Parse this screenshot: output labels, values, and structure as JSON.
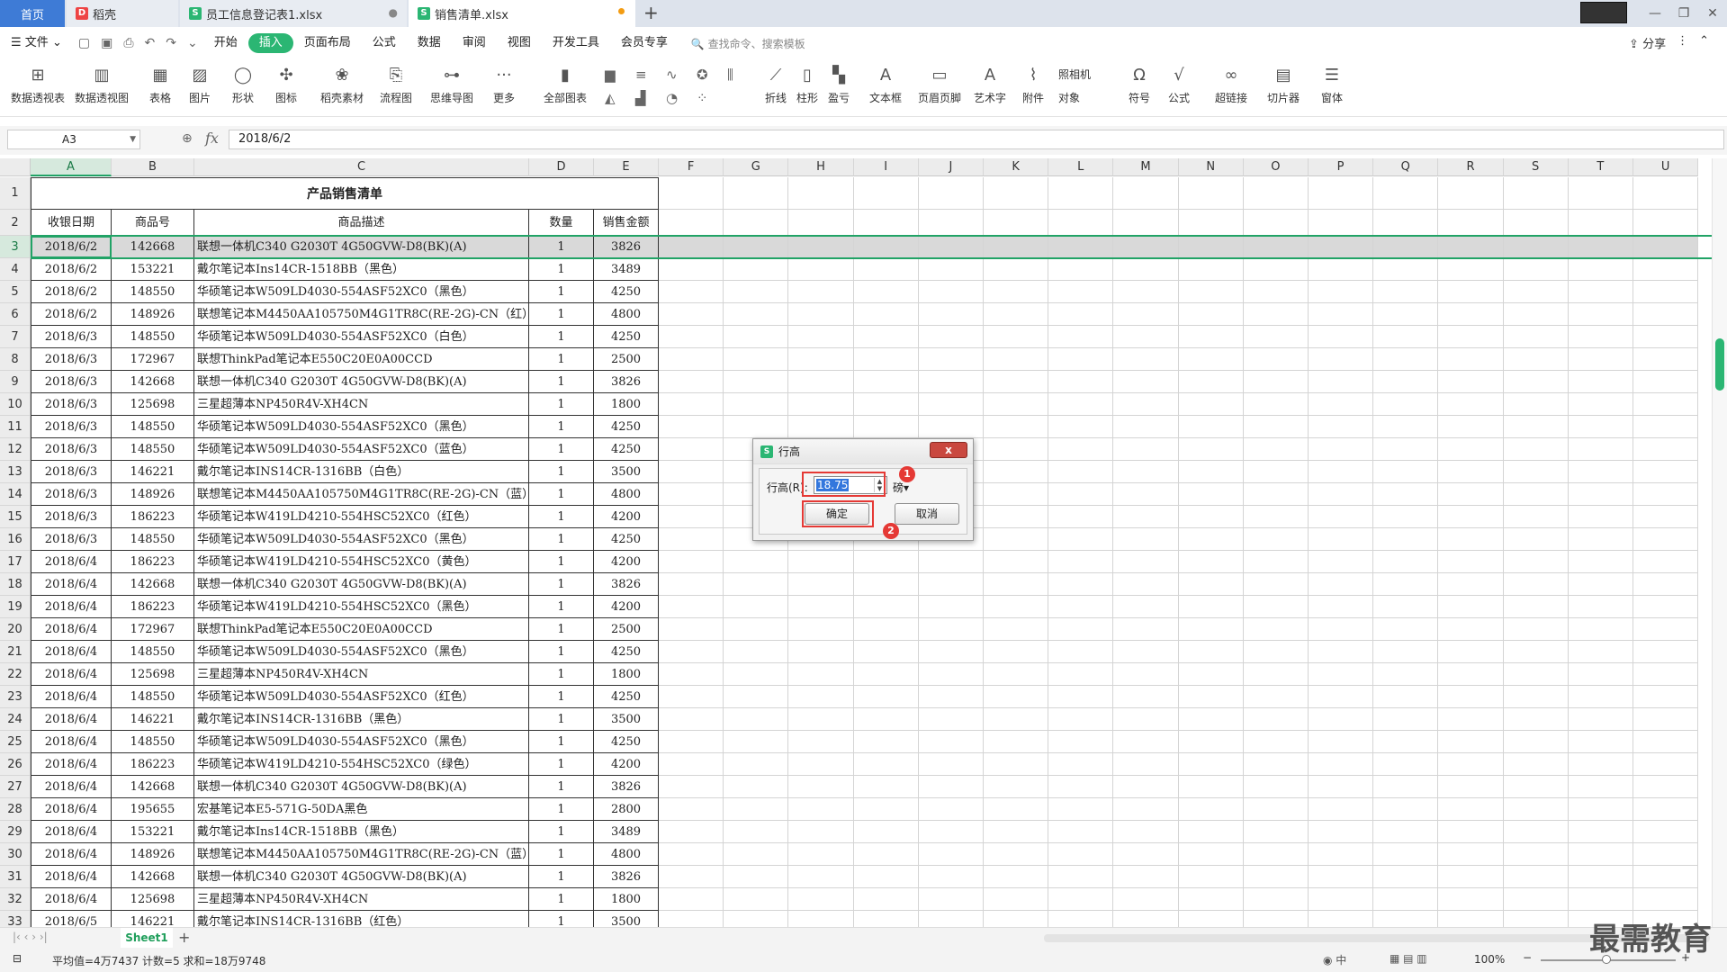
{
  "tabs": {
    "home": "首页",
    "docer": "稻壳",
    "file1": "员工信息登记表1.xlsx",
    "file2": "销售清单.xlsx"
  },
  "menu": {
    "file": "文件",
    "items": [
      "开始",
      "插入",
      "页面布局",
      "公式",
      "数据",
      "审阅",
      "视图",
      "开发工具",
      "会员专享"
    ],
    "active": "插入",
    "search": "查找命令、搜索模板",
    "right_share": "分享"
  },
  "ribbon": [
    {
      "label": "数据透视表",
      "icon": "pivot-table-icon"
    },
    {
      "label": "数据透视图",
      "icon": "pivot-chart-icon"
    },
    {
      "label": "表格",
      "icon": "table-icon"
    },
    {
      "label": "图片",
      "icon": "picture-icon"
    },
    {
      "label": "形状",
      "icon": "shape-icon"
    },
    {
      "label": "图标",
      "icon": "icon-library-icon"
    },
    {
      "label": "稻壳素材",
      "icon": "material-icon"
    },
    {
      "label": "流程图",
      "icon": "flowchart-icon"
    },
    {
      "label": "思维导图",
      "icon": "mindmap-icon"
    },
    {
      "label": "更多",
      "icon": "more-icon"
    },
    {
      "label": "全部图表",
      "icon": "all-charts-icon"
    },
    {
      "label": "折线",
      "icon": "sparkline-line-icon"
    },
    {
      "label": "柱形",
      "icon": "sparkline-column-icon"
    },
    {
      "label": "盈亏",
      "icon": "sparkline-winloss-icon"
    },
    {
      "label": "文本框",
      "icon": "textbox-icon"
    },
    {
      "label": "页眉页脚",
      "icon": "header-footer-icon"
    },
    {
      "label": "艺术字",
      "icon": "wordart-icon"
    },
    {
      "label": "附件",
      "icon": "attachment-icon"
    },
    {
      "label": "符号",
      "icon": "symbol-icon"
    },
    {
      "label": "公式",
      "icon": "equation-icon"
    },
    {
      "label": "超链接",
      "icon": "hyperlink-icon"
    },
    {
      "label": "切片器",
      "icon": "slicer-icon"
    },
    {
      "label": "窗体",
      "icon": "form-icon"
    }
  ],
  "ribbon_small": {
    "camera": "照相机",
    "object": "对象"
  },
  "formula": {
    "cell_ref": "A3",
    "content": "2018/6/2",
    "fx": "fx"
  },
  "columns": [
    "A",
    "B",
    "C",
    "D",
    "E",
    "F",
    "G",
    "H",
    "I",
    "J",
    "K",
    "L",
    "M",
    "N",
    "O",
    "P",
    "Q",
    "R",
    "S",
    "T",
    "U"
  ],
  "sheet": {
    "title": "产品销售清单",
    "headers": [
      "收银日期",
      "商品号",
      "商品描述",
      "数量",
      "销售金额"
    ],
    "rows": [
      [
        "2018/6/2",
        "142668",
        "联想一体机C340 G2030T 4G50GVW-D8(BK)(A)",
        "1",
        "3826"
      ],
      [
        "2018/6/2",
        "153221",
        "戴尔笔记本Ins14CR-1518BB（黑色）",
        "1",
        "3489"
      ],
      [
        "2018/6/2",
        "148550",
        "华硕笔记本W509LD4030-554ASF52XC0（黑色）",
        "1",
        "4250"
      ],
      [
        "2018/6/2",
        "148926",
        "联想笔记本M4450AA105750M4G1TR8C(RE-2G)-CN（红）",
        "1",
        "4800"
      ],
      [
        "2018/6/3",
        "148550",
        "华硕笔记本W509LD4030-554ASF52XC0（白色）",
        "1",
        "4250"
      ],
      [
        "2018/6/3",
        "172967",
        "联想ThinkPad笔记本E550C20E0A00CCD",
        "1",
        "2500"
      ],
      [
        "2018/6/3",
        "142668",
        "联想一体机C340 G2030T 4G50GVW-D8(BK)(A)",
        "1",
        "3826"
      ],
      [
        "2018/6/3",
        "125698",
        "三星超薄本NP450R4V-XH4CN",
        "1",
        "1800"
      ],
      [
        "2018/6/3",
        "148550",
        "华硕笔记本W509LD4030-554ASF52XC0（黑色）",
        "1",
        "4250"
      ],
      [
        "2018/6/3",
        "148550",
        "华硕笔记本W509LD4030-554ASF52XC0（蓝色）",
        "1",
        "4250"
      ],
      [
        "2018/6/3",
        "146221",
        "戴尔笔记本INS14CR-1316BB（白色）",
        "1",
        "3500"
      ],
      [
        "2018/6/3",
        "148926",
        "联想笔记本M4450AA105750M4G1TR8C(RE-2G)-CN（蓝）",
        "1",
        "4800"
      ],
      [
        "2018/6/3",
        "186223",
        "华硕笔记本W419LD4210-554HSC52XC0（红色）",
        "1",
        "4200"
      ],
      [
        "2018/6/3",
        "148550",
        "华硕笔记本W509LD4030-554ASF52XC0（黑色）",
        "1",
        "4250"
      ],
      [
        "2018/6/4",
        "186223",
        "华硕笔记本W419LD4210-554HSC52XC0（黄色）",
        "1",
        "4200"
      ],
      [
        "2018/6/4",
        "142668",
        "联想一体机C340 G2030T 4G50GVW-D8(BK)(A)",
        "1",
        "3826"
      ],
      [
        "2018/6/4",
        "186223",
        "华硕笔记本W419LD4210-554HSC52XC0（黑色）",
        "1",
        "4200"
      ],
      [
        "2018/6/4",
        "172967",
        "联想ThinkPad笔记本E550C20E0A00CCD",
        "1",
        "2500"
      ],
      [
        "2018/6/4",
        "148550",
        "华硕笔记本W509LD4030-554ASF52XC0（黑色）",
        "1",
        "4250"
      ],
      [
        "2018/6/4",
        "125698",
        "三星超薄本NP450R4V-XH4CN",
        "1",
        "1800"
      ],
      [
        "2018/6/4",
        "148550",
        "华硕笔记本W509LD4030-554ASF52XC0（红色）",
        "1",
        "4250"
      ],
      [
        "2018/6/4",
        "146221",
        "戴尔笔记本INS14CR-1316BB（黑色）",
        "1",
        "3500"
      ],
      [
        "2018/6/4",
        "148550",
        "华硕笔记本W509LD4030-554ASF52XC0（黑色）",
        "1",
        "4250"
      ],
      [
        "2018/6/4",
        "186223",
        "华硕笔记本W419LD4210-554HSC52XC0（绿色）",
        "1",
        "4200"
      ],
      [
        "2018/6/4",
        "142668",
        "联想一体机C340 G2030T 4G50GVW-D8(BK)(A)",
        "1",
        "3826"
      ],
      [
        "2018/6/4",
        "195655",
        "宏基笔记本E5-571G-50DA黑色",
        "1",
        "2800"
      ],
      [
        "2018/6/4",
        "153221",
        "戴尔笔记本Ins14CR-1518BB（黑色）",
        "1",
        "3489"
      ],
      [
        "2018/6/4",
        "148926",
        "联想笔记本M4450AA105750M4G1TR8C(RE-2G)-CN（蓝）",
        "1",
        "4800"
      ],
      [
        "2018/6/4",
        "142668",
        "联想一体机C340 G2030T 4G50GVW-D8(BK)(A)",
        "1",
        "3826"
      ],
      [
        "2018/6/4",
        "125698",
        "三星超薄本NP450R4V-XH4CN",
        "1",
        "1800"
      ],
      [
        "2018/6/5",
        "146221",
        "戴尔笔记本INS14CR-1316BB（红色）",
        "1",
        "3500"
      ]
    ]
  },
  "dialog": {
    "title": "行高",
    "label": "行高(R):",
    "value": "18.75",
    "unit": "磅",
    "ok": "确定",
    "cancel": "取消",
    "close": "x",
    "badge1": "1",
    "badge2": "2"
  },
  "sheetbar": {
    "sheet_name": "Sheet1",
    "add": "+"
  },
  "status": {
    "summary": "平均值=4万7437  计数=5  求和=18万9748",
    "zoom": "100%"
  },
  "watermark": "最需教育",
  "colors": {
    "accent": "#2bb673",
    "home_tab": "#3e7bd6",
    "highlight": "#e53935"
  }
}
